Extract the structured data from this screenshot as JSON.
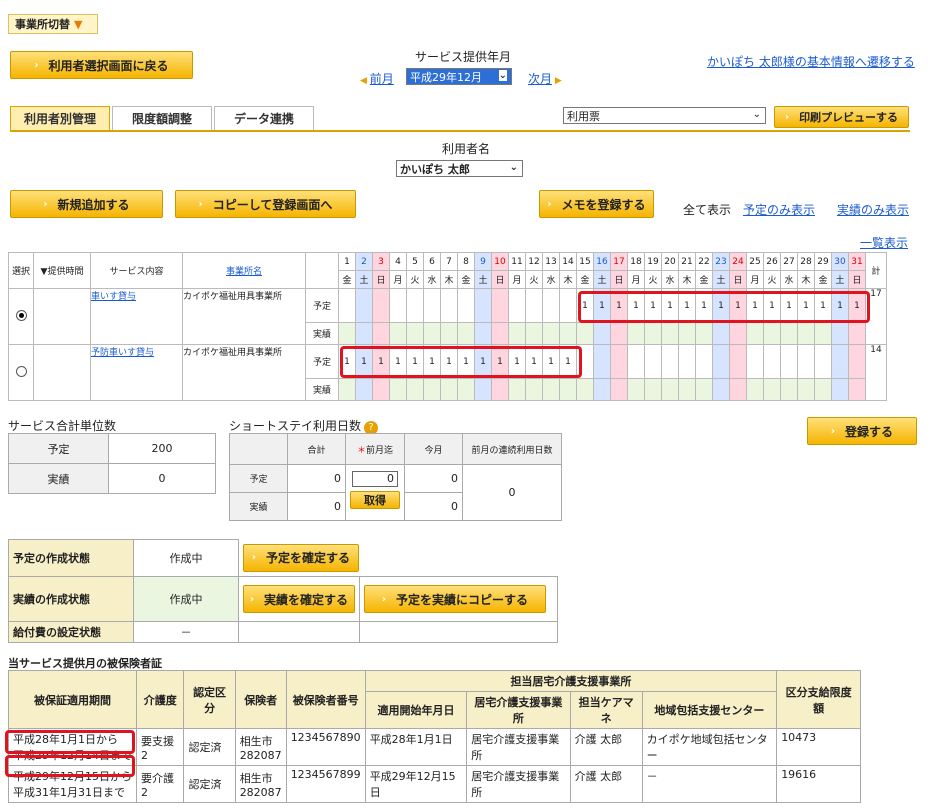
{
  "office_switch": "事業所切替",
  "back_button": "利用者選択画面に戻る",
  "month": {
    "title": "サービス提供年月",
    "prev": "前月",
    "selected": "平成29年12月",
    "next": "次月"
  },
  "basic_info_link": "かいぽち 太郎様の基本情報へ遷移する",
  "tabs": [
    "利用者別管理",
    "限度額調整",
    "データ連携"
  ],
  "form_select": "利用票",
  "print_button": "印刷プレビューする",
  "user": {
    "label": "利用者名",
    "name": "かいぽち 太郎"
  },
  "actions": {
    "new": "新規追加する",
    "copy": "コピーして登録画面へ",
    "memo": "メモを登録する"
  },
  "display": {
    "all": "全て表示",
    "plan": "予定のみ表示",
    "actual": "実績のみ表示",
    "list": "一覧表示"
  },
  "calendar": {
    "headers": {
      "select": "選択",
      "time": "▼提供時間",
      "service": "サービス内容",
      "office": "事業所名",
      "total": "計"
    },
    "days": [
      "1",
      "2",
      "3",
      "4",
      "5",
      "6",
      "7",
      "8",
      "9",
      "10",
      "11",
      "12",
      "13",
      "14",
      "15",
      "16",
      "17",
      "18",
      "19",
      "20",
      "21",
      "22",
      "23",
      "24",
      "25",
      "26",
      "27",
      "28",
      "29",
      "30",
      "31"
    ],
    "weekdays": [
      "金",
      "土",
      "日",
      "月",
      "火",
      "水",
      "木",
      "金",
      "土",
      "日",
      "月",
      "火",
      "水",
      "木",
      "金",
      "土",
      "日",
      "月",
      "火",
      "水",
      "木",
      "金",
      "土",
      "日",
      "月",
      "火",
      "水",
      "木",
      "金",
      "土",
      "日"
    ],
    "rows": [
      {
        "service": "車いす貸与",
        "office": "カイポケ福祉用具事業所",
        "plan_label": "予定",
        "actual_label": "実績",
        "plan": [
          "",
          "",
          "",
          "",
          "",
          "",
          "",
          "",
          "",
          "",
          "",
          "",
          "",
          "",
          "1",
          "1",
          "1",
          "1",
          "1",
          "1",
          "1",
          "1",
          "1",
          "1",
          "1",
          "1",
          "1",
          "1",
          "1",
          "1",
          "1"
        ],
        "total": "17",
        "selected": true
      },
      {
        "service": "予防車いす貸与",
        "office": "カイポケ福祉用具事業所",
        "plan_label": "予定",
        "actual_label": "実績",
        "plan": [
          "1",
          "1",
          "1",
          "1",
          "1",
          "1",
          "1",
          "1",
          "1",
          "1",
          "1",
          "1",
          "1",
          "1",
          "",
          "",
          "",
          "",
          "",
          "",
          "",
          "",
          "",
          "",
          "",
          "",
          "",
          "",
          "",
          "",
          ""
        ],
        "total": "14",
        "selected": false
      }
    ]
  },
  "units": {
    "title": "サービス合計単位数",
    "plan_label": "予定",
    "plan": "200",
    "actual_label": "実績",
    "actual": "0"
  },
  "short": {
    "title": "ショートステイ利用日数",
    "total": "合計",
    "prev": "前月迄",
    "cur": "今月",
    "cont": "前月の連続利用日数",
    "plan_label": "予定",
    "actual_label": "実績",
    "plan_total": "0",
    "plan_prev": "0",
    "plan_cur": "0",
    "actual_total": "0",
    "actual_cur": "0",
    "cont_val": "0",
    "fetch": "取得"
  },
  "register_button": "登録する",
  "status": {
    "plan_label": "予定の作成状態",
    "plan_val": "作成中",
    "plan_btn": "予定を確定する",
    "actual_label": "実績の作成状態",
    "actual_val": "作成中",
    "actual_btn": "実績を確定する",
    "copy_btn": "予定を実績にコピーする",
    "benefit_label": "給付費の設定状態",
    "benefit_val": "－"
  },
  "insurance": {
    "title": "当サービス提供月の被保険者証",
    "h": {
      "period": "被保証適用期間",
      "care": "介護度",
      "cert": "認定区分",
      "insurer": "保険者",
      "num": "被保険者番号",
      "office": "担当居宅介護支援事業所",
      "start": "適用開始年月日",
      "home": "居宅介護支援事業所",
      "cm": "担当ケアマネ",
      "center": "地域包括支援センター",
      "limit": "区分支給限度額"
    },
    "rows": [
      {
        "p1": "平成28年1月1日から",
        "p2": "平成29年12月14日まで",
        "care": "要支援2",
        "cert": "認定済",
        "ins1": "相生市",
        "ins2": "282087",
        "num": "1234567890",
        "start": "平成28年1月1日",
        "home": "居宅介護支援事業所",
        "cm": "介護 太郎",
        "center": "カイポケ地域包括センター",
        "limit": "10473"
      },
      {
        "p1": "平成29年12月15日から",
        "p2": "平成31年1月31日まで",
        "care": "要介護2",
        "cert": "認定済",
        "ins1": "相生市",
        "ins2": "282087",
        "num": "1234567899",
        "start": "平成29年12月15日",
        "home": "居宅介護支援事業所",
        "cm": "介護 太郎",
        "center": "－",
        "limit": "19616"
      }
    ]
  }
}
